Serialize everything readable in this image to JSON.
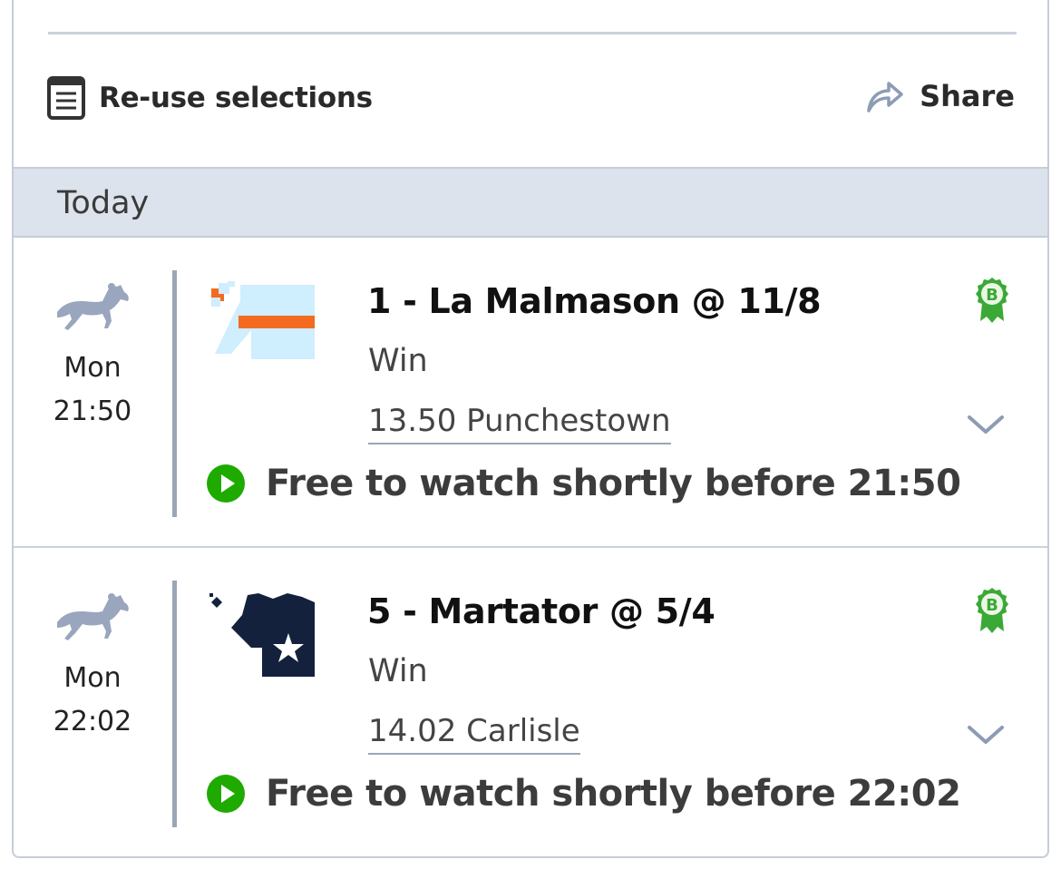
{
  "actions": {
    "reuse_label": "Re-use selections",
    "share_label": "Share"
  },
  "section": {
    "date_label": "Today"
  },
  "bets": [
    {
      "day": "Mon",
      "time": "21:50",
      "selection": "1 - La Malmason @ 11/8",
      "market": "Win",
      "event": "13.50 Punchestown",
      "watch_text": "Free to watch shortly before 21:50",
      "boost_badge": "B",
      "silks_colors": {
        "body": "#cfeefe",
        "accent": "#f26b21"
      }
    },
    {
      "day": "Mon",
      "time": "22:02",
      "selection": "5 - Martator @ 5/4",
      "market": "Win",
      "event": "14.02 Carlisle",
      "watch_text": "Free to watch shortly before 22:02",
      "boost_badge": "B",
      "silks_colors": {
        "body": "#14213d",
        "accent": "#ffffff"
      }
    }
  ],
  "colors": {
    "play_green": "#1faa00",
    "boost_green": "#3aa935",
    "icon_grey": "#9aa6bd",
    "header_bg": "#dde3ec"
  },
  "icons": [
    "reuse-list-icon",
    "share-arrow-icon",
    "horse-racing-icon",
    "boost-badge-icon",
    "chevron-down-icon",
    "play-icon"
  ]
}
